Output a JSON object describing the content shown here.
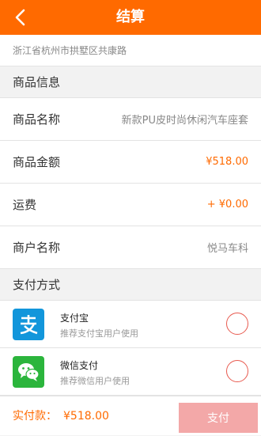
{
  "header": {
    "title": "结算",
    "back_icon": "chevron-left-icon"
  },
  "address": "浙江省杭州市拱墅区共康路",
  "goods_section": {
    "title": "商品信息"
  },
  "goods": {
    "name_label": "商品名称",
    "name_value": "新款PU皮时尚休闲汽车座套",
    "amount_label": "商品金额",
    "amount_value": "¥518.00",
    "shipping_label": "运费",
    "shipping_value": "+ ¥0.00",
    "merchant_label": "商户名称",
    "merchant_value": "悦马车科"
  },
  "payment_section": {
    "title": "支付方式"
  },
  "payment_methods": [
    {
      "name": "支付宝",
      "desc": "推荐支付宝用户使用",
      "icon": "alipay-icon",
      "color": "#1296db"
    },
    {
      "name": "微信支付",
      "desc": "推荐微信用户使用",
      "icon": "wechat-icon",
      "color": "#2bb53c"
    }
  ],
  "footer": {
    "total_label": "实付款：",
    "total_value": "¥518.00",
    "pay_button": "支付"
  },
  "colors": {
    "accent": "#ff6a00",
    "radio": "#e85a4f",
    "pay_button_bg": "#f3a8a8"
  }
}
